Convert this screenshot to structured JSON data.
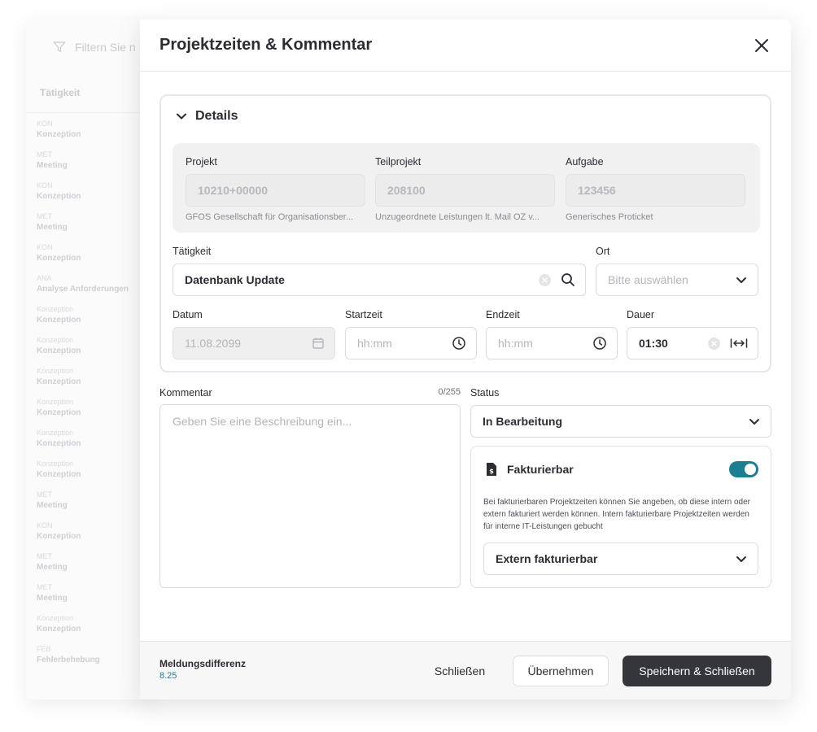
{
  "background": {
    "filter_placeholder": "Filtern Sie n",
    "column_header": "Tätigkeit",
    "rows": [
      {
        "code": "KON",
        "name": "Konzeption"
      },
      {
        "code": "MET",
        "name": "Meeting"
      },
      {
        "code": "KON",
        "name": "Konzeption"
      },
      {
        "code": "MET",
        "name": "Meeting"
      },
      {
        "code": "KON",
        "name": "Konzeption"
      },
      {
        "code": "ANA",
        "name": "Analyse Anforderungen"
      },
      {
        "code": "Konzeption",
        "name": "Konzeption"
      },
      {
        "code": "Konzeption",
        "name": "Konzeption"
      },
      {
        "code": "Konzeption",
        "name": "Konzeption"
      },
      {
        "code": "Konzeption",
        "name": "Konzeption"
      },
      {
        "code": "Konzeption",
        "name": "Konzeption"
      },
      {
        "code": "Konzeption",
        "name": "Konzeption"
      },
      {
        "code": "MET",
        "name": "Meeting"
      },
      {
        "code": "KON",
        "name": "Konzeption"
      },
      {
        "code": "MET",
        "name": "Meeting"
      },
      {
        "code": "MET",
        "name": "Meeting"
      },
      {
        "code": "Konzeption",
        "name": "Konzeption"
      },
      {
        "code": "FEB",
        "name": "Fehlerbehebung"
      }
    ]
  },
  "modal": {
    "title": "Projektzeiten & Kommentar",
    "details": {
      "title": "Details",
      "projekt": {
        "label": "Projekt",
        "value": "10210+00000",
        "sub": "GFOS Gesellschaft für Organisationsber..."
      },
      "teilprojekt": {
        "label": "Teilprojekt",
        "value": "208100",
        "sub": "Unzugeordnete Leistungen lt. Mail OZ v..."
      },
      "aufgabe": {
        "label": "Aufgabe",
        "value": "123456",
        "sub": "Generisches Proticket"
      },
      "taetigkeit": {
        "label": "Tätigkeit",
        "value": "Datenbank Update"
      },
      "ort": {
        "label": "Ort",
        "placeholder": "Bitte auswählen"
      },
      "datum": {
        "label": "Datum",
        "value": "11.08.2099"
      },
      "startzeit": {
        "label": "Startzeit",
        "placeholder": "hh:mm"
      },
      "endzeit": {
        "label": "Endzeit",
        "placeholder": "hh:mm"
      },
      "dauer": {
        "label": "Dauer",
        "value": "01:30"
      }
    },
    "kommentar": {
      "label": "Kommentar",
      "count": "0/255",
      "placeholder": "Geben Sie eine Beschreibung ein..."
    },
    "status": {
      "label": "Status",
      "value": "In Bearbeitung"
    },
    "fakturierbar": {
      "label": "Fakturierbar",
      "enabled": true,
      "description": "Bei fakturierbaren Projektzeiten können Sie angeben, ob diese intern oder extern fakturiert werden können. Intern fakturierbare Projektzeiten werden für interne IT-Leistungen gebucht",
      "selection": "Extern fakturierbar"
    },
    "footer": {
      "diff_label": "Meldungsdifferenz",
      "diff_value": "8.25",
      "close_label": "Schließen",
      "apply_label": "Übernehmen",
      "save_label": "Speichern & Schließen"
    }
  },
  "colors": {
    "accent": "#1b7f91",
    "primary_button": "#34363b"
  }
}
